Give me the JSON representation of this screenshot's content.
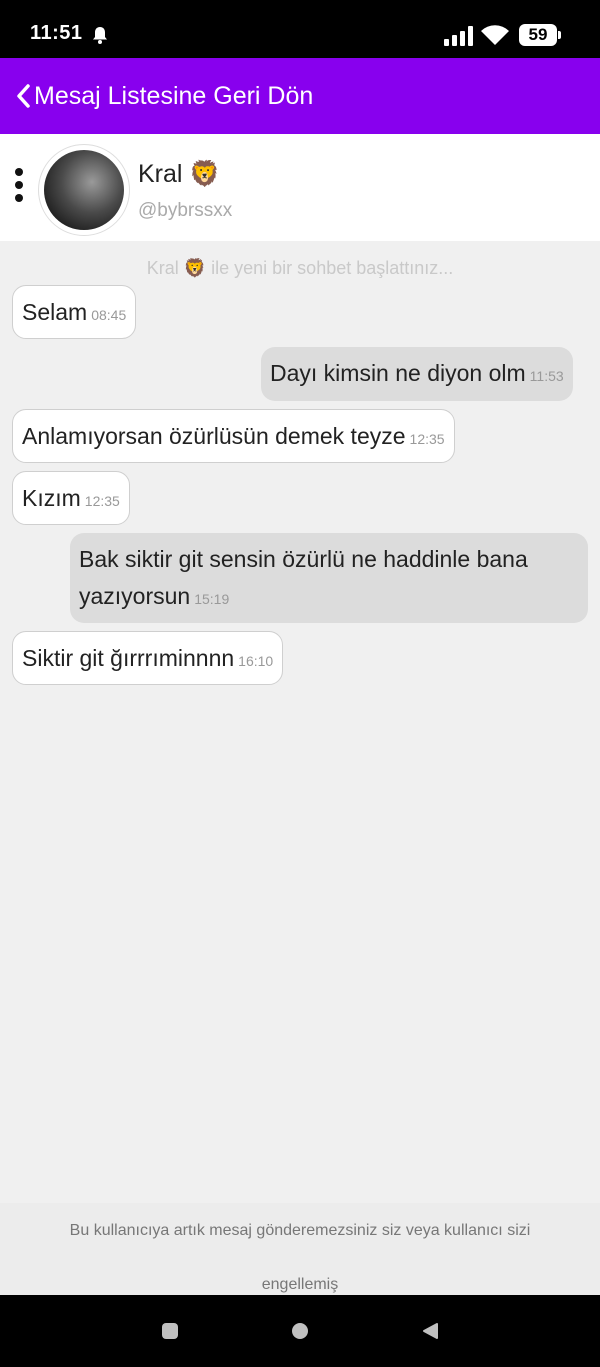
{
  "status_bar": {
    "time": "11:51",
    "battery": "59"
  },
  "header": {
    "back_label": "Mesaj Listesine Geri Dön"
  },
  "profile": {
    "name": "Kral 🦁",
    "handle": "@bybrssxx"
  },
  "chat": {
    "start_notice": "Kral 🦁 ile yeni bir sohbet başlattınız...",
    "messages": [
      {
        "text": "Selam",
        "time": "08:45",
        "direction": "in"
      },
      {
        "text": "Dayı kimsin ne diyon olm",
        "time": "11:53",
        "direction": "out"
      },
      {
        "text": "Anlamıyorsan özürlüsün demek teyze",
        "time": "12:35",
        "direction": "in"
      },
      {
        "text": "Kızım",
        "time": "12:35",
        "direction": "in"
      },
      {
        "text": "Bak siktir git sensin özürlü ne haddinle bana",
        "text2": "yazıyorsun",
        "time": "15:19",
        "direction": "out"
      },
      {
        "text": "Siktir git ğırrrıminnnn",
        "time": "16:10",
        "direction": "in"
      }
    ]
  },
  "footer": {
    "blocked_notice": "Bu kullanıcıya artık mesaj gönderemezsiniz siz veya kullanıcı sizi engellemiş"
  },
  "colors": {
    "header_bg": "#8800ee",
    "incoming_bubble": "#ffffff",
    "outgoing_bubble": "#dcdcdc"
  }
}
